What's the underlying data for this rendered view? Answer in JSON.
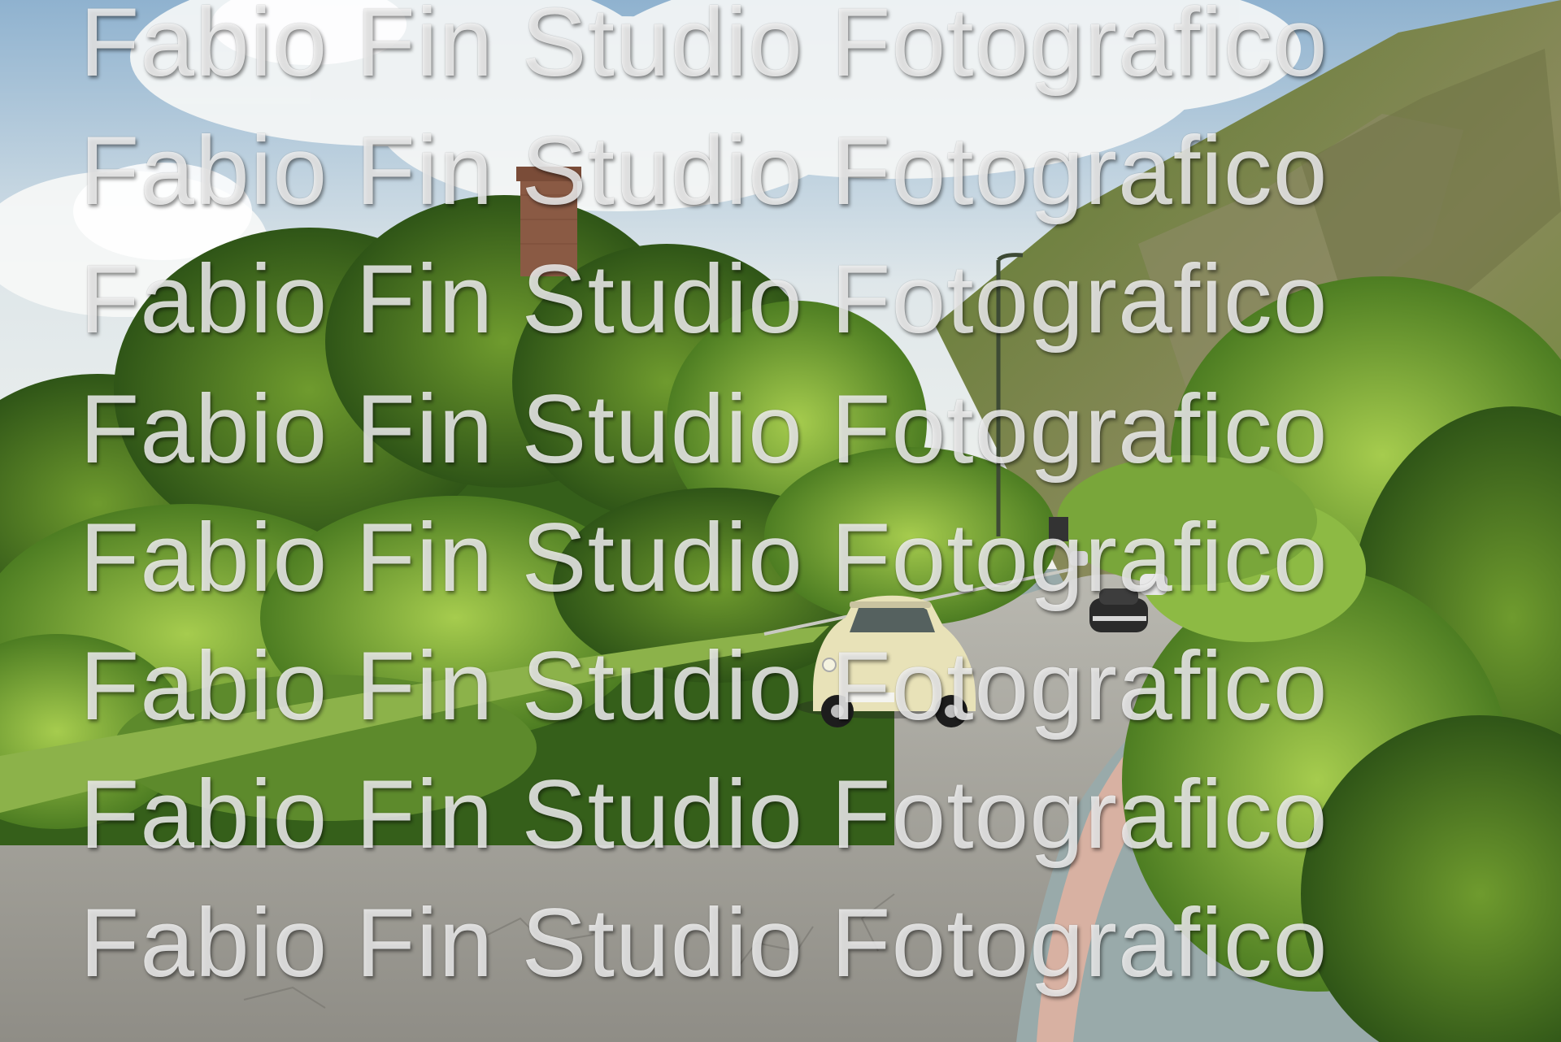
{
  "photo": {
    "subject": "Vintage cream Fiat 500 driving on a rural road past green hills and a brick tower",
    "palette": {
      "sky": "#c9d9e4",
      "cloud": "#f4f6f6",
      "foliage_dark": "#3f6a1e",
      "foliage_light": "#7fae3a",
      "hill_rock": "#7d7b56",
      "road": "#a7a59c",
      "tower": "#8a5a44",
      "car_body": "#e8e2b8",
      "curb": "#d9b4a6"
    }
  },
  "watermark": {
    "lines": [
      "Fabio Fin Studio Fotografico",
      "Fabio Fin Studio Fotografico",
      "Fabio Fin Studio Fotografico",
      "Fabio Fin Studio Fotografico",
      "Fabio Fin Studio Fotografico",
      "Fabio Fin Studio Fotografico",
      "Fabio Fin Studio Fotografico",
      "Fabio Fin Studio Fotografico"
    ]
  }
}
